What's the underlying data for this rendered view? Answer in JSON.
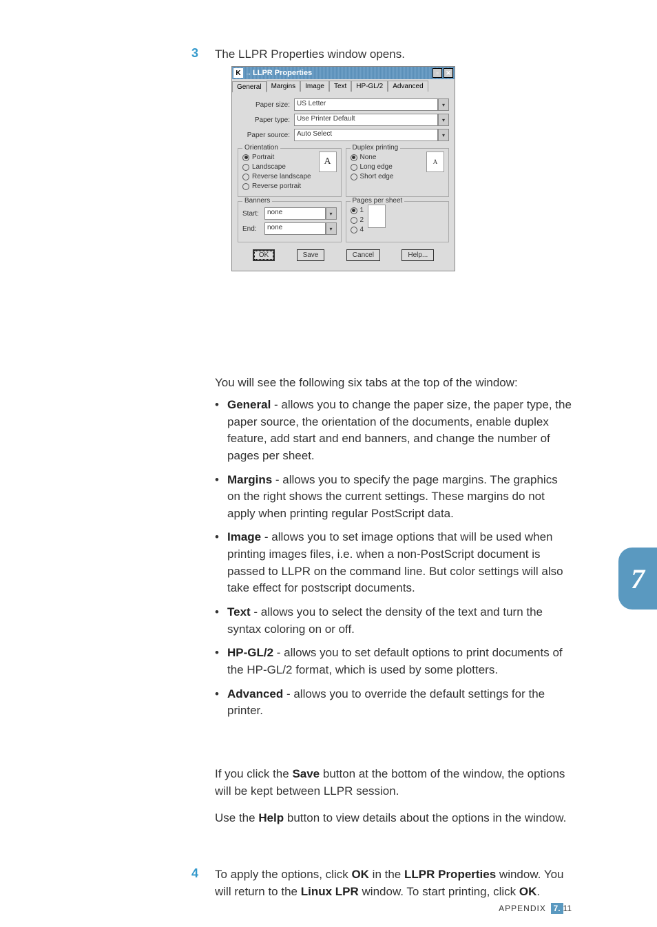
{
  "step3": {
    "num": "3",
    "intro": "The LLPR Properties window opens."
  },
  "dialog": {
    "title": "LLPR Properties",
    "tabs": [
      "General",
      "Margins",
      "Image",
      "Text",
      "HP-GL/2",
      "Advanced"
    ],
    "paper_size_label": "Paper size:",
    "paper_size_value": "US Letter",
    "paper_type_label": "Paper type:",
    "paper_type_value": "Use Printer Default",
    "paper_source_label": "Paper source:",
    "paper_source_value": "Auto Select",
    "orientation": {
      "legend": "Orientation",
      "opts": [
        "Portrait",
        "Landscape",
        "Reverse landscape",
        "Reverse portrait"
      ],
      "preview": "A"
    },
    "duplex": {
      "legend": "Duplex printing",
      "opts": [
        "None",
        "Long edge",
        "Short edge"
      ],
      "preview": "A"
    },
    "banners": {
      "legend": "Banners",
      "start_label": "Start:",
      "start_value": "none",
      "end_label": "End:",
      "end_value": "none"
    },
    "pps": {
      "legend": "Pages per sheet",
      "opts": [
        "1",
        "2",
        "4"
      ]
    },
    "buttons": {
      "ok": "OK",
      "save": "Save",
      "cancel": "Cancel",
      "help": "Help..."
    }
  },
  "tabs_intro": "You will see the following six tabs at the top of the window:",
  "bullets": [
    {
      "b": "General",
      "t": " - allows you to change the paper size, the paper type, the paper source, the orientation of the documents, enable duplex feature, add start and end banners, and change the number of pages per sheet."
    },
    {
      "b": "Margins",
      "t": " - allows you to specify the page margins. The graphics on the right shows the current settings. These margins do not apply when printing regular PostScript data."
    },
    {
      "b": "Image",
      "t": " - allows you to set image options that will be used when printing images files, i.e. when a non-PostScript document is passed to LLPR on the command line. But color settings will also take effect for postscript documents."
    },
    {
      "b": "Text",
      "t": " - allows you to select the density of the text and turn the syntax coloring on or off."
    },
    {
      "b": "HP-GL/2",
      "t": " - allows you to set default options to print documents of the HP-GL/2 format, which is used by some plotters."
    },
    {
      "b": "Advanced",
      "t": " - allows you to override the default settings for the printer."
    }
  ],
  "save_note_1": "If you click the ",
  "save_bold": "Save",
  "save_note_2": " button at the bottom of the window, the options will be kept between LLPR session.",
  "help_note_1": "Use the ",
  "help_bold": "Help",
  "help_note_2": " button to view details about the options in the window.",
  "step4": {
    "num": "4",
    "p1a": "To apply the options, click ",
    "p1b": "OK",
    "p1c": " in the ",
    "p1d": "LLPR Properties",
    "p1e": " window. You will return to the ",
    "p1f": "Linux LPR",
    "p1g": " window. To start printing, click ",
    "p1h": "OK",
    "p1i": "."
  },
  "side_tab": "7",
  "footer": {
    "label": "APPENDIX",
    "page_a": "7.",
    "page_b": "11"
  }
}
